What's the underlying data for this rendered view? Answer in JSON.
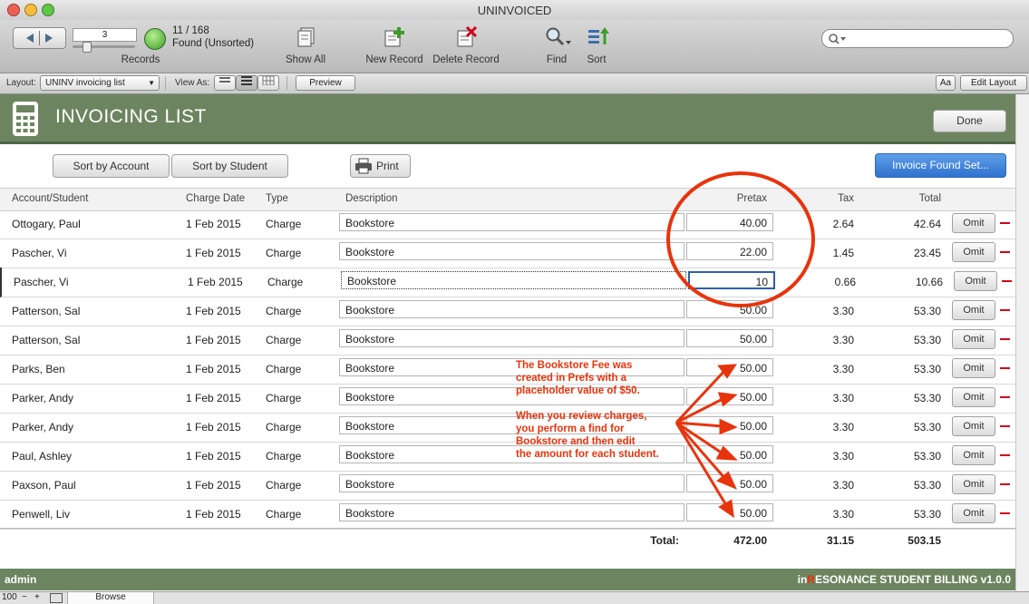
{
  "window": {
    "title": "UNINVOICED"
  },
  "toolbar": {
    "record_value": "3",
    "records_label": "Records",
    "found_count": "11 / 168",
    "found_status": "Found (Unsorted)",
    "show_all": "Show All",
    "new_record": "New Record",
    "delete_record": "Delete Record",
    "find": "Find",
    "sort": "Sort",
    "search_placeholder": ""
  },
  "layoutbar": {
    "layout_label": "Layout:",
    "layout_value": "UNINV invoicing list",
    "view_as_label": "View As:",
    "preview": "Preview",
    "font_glyph": "Aa",
    "edit_layout": "Edit Layout"
  },
  "header": {
    "title": "INVOICING LIST",
    "done": "Done"
  },
  "actions": {
    "sort_by_account": "Sort by Account",
    "sort_by_student": "Sort by Student",
    "print": "Print",
    "invoice_found_set": "Invoice Found Set..."
  },
  "columns": {
    "account": "Account/Student",
    "date": "Charge Date",
    "type": "Type",
    "description": "Description",
    "pretax": "Pretax",
    "tax": "Tax",
    "total": "Total"
  },
  "rows": [
    {
      "name": "Ottogary, Paul",
      "date": "1 Feb 2015",
      "type": "Charge",
      "desc": "Bookstore",
      "pretax": "40.00",
      "tax": "2.64",
      "total": "42.64",
      "omit": "Omit"
    },
    {
      "name": "Pascher, Vi",
      "date": "1 Feb 2015",
      "type": "Charge",
      "desc": "Bookstore",
      "pretax": "22.00",
      "tax": "1.45",
      "total": "23.45",
      "omit": "Omit"
    },
    {
      "name": "Pascher, Vi",
      "date": "1 Feb 2015",
      "type": "Charge",
      "desc": "Bookstore",
      "pretax": "10",
      "tax": "0.66",
      "total": "10.66",
      "omit": "Omit"
    },
    {
      "name": "Patterson, Sal",
      "date": "1 Feb 2015",
      "type": "Charge",
      "desc": "Bookstore",
      "pretax": "50.00",
      "tax": "3.30",
      "total": "53.30",
      "omit": "Omit"
    },
    {
      "name": "Patterson, Sal",
      "date": "1 Feb 2015",
      "type": "Charge",
      "desc": "Bookstore",
      "pretax": "50.00",
      "tax": "3.30",
      "total": "53.30",
      "omit": "Omit"
    },
    {
      "name": "Parks, Ben",
      "date": "1 Feb 2015",
      "type": "Charge",
      "desc": "Bookstore",
      "pretax": "50.00",
      "tax": "3.30",
      "total": "53.30",
      "omit": "Omit"
    },
    {
      "name": "Parker, Andy",
      "date": "1 Feb 2015",
      "type": "Charge",
      "desc": "Bookstore",
      "pretax": "50.00",
      "tax": "3.30",
      "total": "53.30",
      "omit": "Omit"
    },
    {
      "name": "Parker, Andy",
      "date": "1 Feb 2015",
      "type": "Charge",
      "desc": "Bookstore",
      "pretax": "50.00",
      "tax": "3.30",
      "total": "53.30",
      "omit": "Omit"
    },
    {
      "name": "Paul, Ashley",
      "date": "1 Feb 2015",
      "type": "Charge",
      "desc": "Bookstore",
      "pretax": "50.00",
      "tax": "3.30",
      "total": "53.30",
      "omit": "Omit"
    },
    {
      "name": "Paxson, Paul",
      "date": "1 Feb 2015",
      "type": "Charge",
      "desc": "Bookstore",
      "pretax": "50.00",
      "tax": "3.30",
      "total": "53.30",
      "omit": "Omit"
    },
    {
      "name": "Penwell, Liv",
      "date": "1 Feb 2015",
      "type": "Charge",
      "desc": "Bookstore",
      "pretax": "50.00",
      "tax": "3.30",
      "total": "53.30",
      "omit": "Omit"
    }
  ],
  "totals": {
    "label": "Total:",
    "pretax": "472.00",
    "tax": "31.15",
    "total": "503.15"
  },
  "annotation": {
    "line1": "The Bookstore Fee was",
    "line2": "created in Prefs with a",
    "line3": "placeholder value of $50.",
    "line4": "When you review charges,",
    "line5": "you perform a find for",
    "line6": "Bookstore and then edit",
    "line7": "the amount for each student."
  },
  "footer": {
    "user": "admin",
    "brand_prefix": "in",
    "brand_r": "R",
    "brand_rest": "ESONANCE STUDENT BILLING v1.0.0"
  },
  "statusbar": {
    "zoom": "100",
    "mode": "Browse"
  },
  "colors": {
    "header_green": "#6c8560",
    "accent_blue": "#3a7fd5",
    "annotation_red": "#e8340c",
    "minus_red": "#d0021b"
  }
}
